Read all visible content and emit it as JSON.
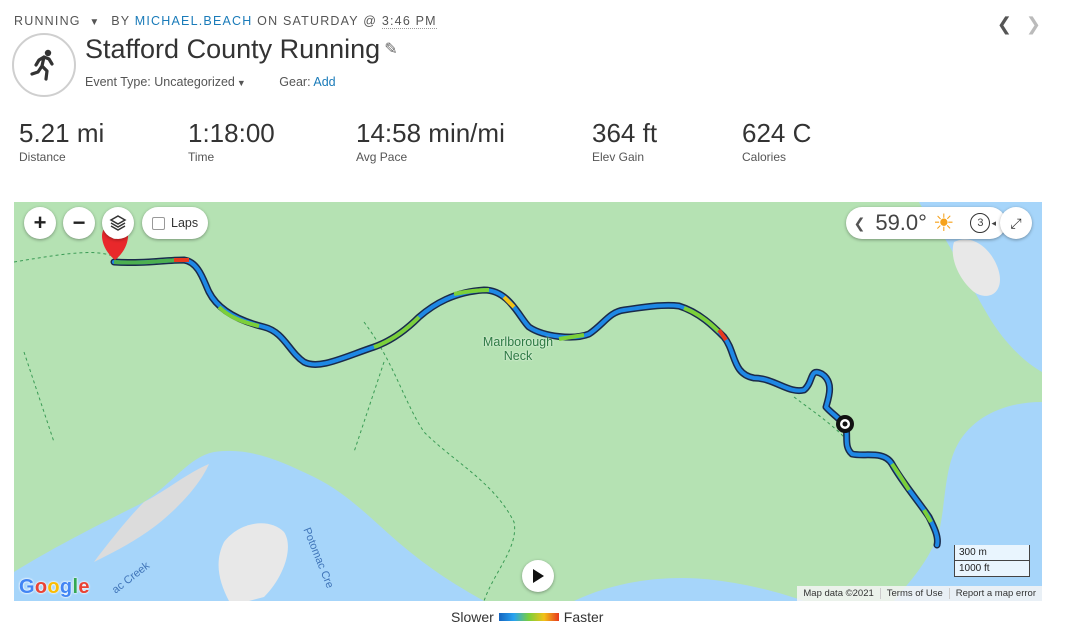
{
  "header": {
    "activity_type": "RUNNING",
    "by": "BY",
    "user": "MICHAEL.BEACH",
    "on_label": "ON SATURDAY @",
    "time": "3:46 PM",
    "prev_icon": "chevron-left-icon",
    "next_icon": "chevron-right-icon"
  },
  "activity": {
    "icon": "runner-icon",
    "title": "Stafford County Running",
    "event_type_label": "Event Type:",
    "event_type_value": "Uncategorized",
    "gear_label": "Gear:",
    "gear_action": "Add"
  },
  "stats": [
    {
      "value": "5.21 mi",
      "label": "Distance"
    },
    {
      "value": "1:18:00",
      "label": "Time"
    },
    {
      "value": "14:58 min/mi",
      "label": "Avg Pace"
    },
    {
      "value": "364 ft",
      "label": "Elev Gain"
    },
    {
      "value": "624 C",
      "label": "Calories"
    }
  ],
  "map": {
    "zoom_in": "+",
    "zoom_out": "−",
    "laps_label": "Laps",
    "weather_temp": "59.0°",
    "weather_count": "3",
    "place_label_line1": "Marlborough",
    "place_label_line2": "Neck",
    "creek_label_1": "ac Creek",
    "creek_label_2": "Potomac Cre",
    "google_logo": "Google",
    "scale_metric": "300 m",
    "scale_imperial": "1000 ft",
    "attribution": [
      "Map data ©2021",
      "Terms of Use",
      "Report a map error"
    ],
    "colors": {
      "land": "#b5e2b3",
      "water": "#a6d5fa",
      "track_slow": "#e8391f",
      "track_fast": "#1565c0"
    }
  },
  "legend": {
    "slower": "Slower",
    "faster": "Faster"
  }
}
